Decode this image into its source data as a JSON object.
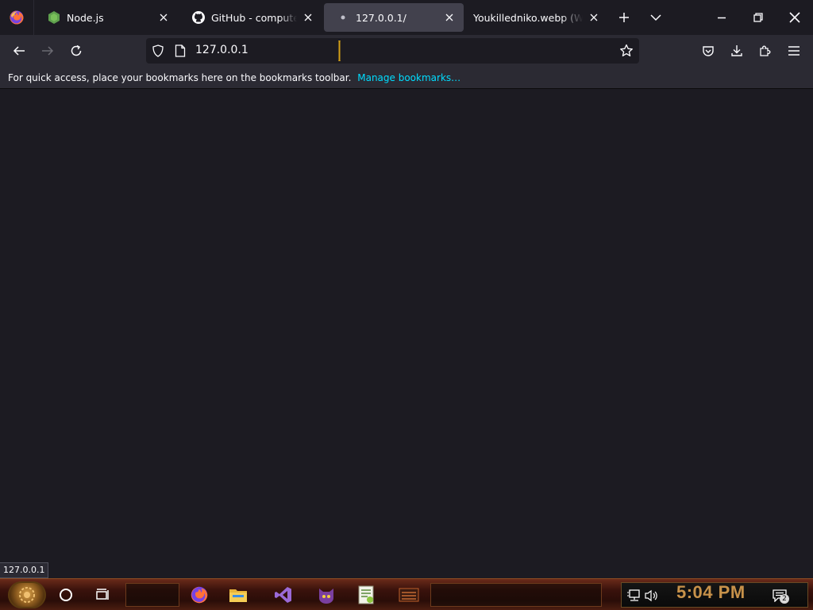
{
  "tabs": [
    {
      "title": "Node.js",
      "icon": "nodejs-icon",
      "active": false
    },
    {
      "title": "GitHub - computernew",
      "icon": "github-icon",
      "active": false
    },
    {
      "title": "127.0.0.1/",
      "icon": "loading-dot-icon",
      "active": true
    },
    {
      "title": "Youkilledniko.webp (WEBP",
      "icon": "image-icon",
      "active": false
    }
  ],
  "navbar": {
    "url": "127.0.0.1"
  },
  "bookmarks_bar": {
    "message": "For quick access, place your bookmarks here on the bookmarks toolbar.",
    "manage_link": "Manage bookmarks…"
  },
  "status_tooltip": "127.0.0.1",
  "taskbar": {
    "clock": "5:04 PM",
    "notification_count": "2"
  },
  "colors": {
    "accent_link": "#00ddff",
    "active_tab": "#42414d",
    "toolbar": "#2b2a33",
    "page_bg": "#1c1b22",
    "clock": "#c8924a"
  }
}
